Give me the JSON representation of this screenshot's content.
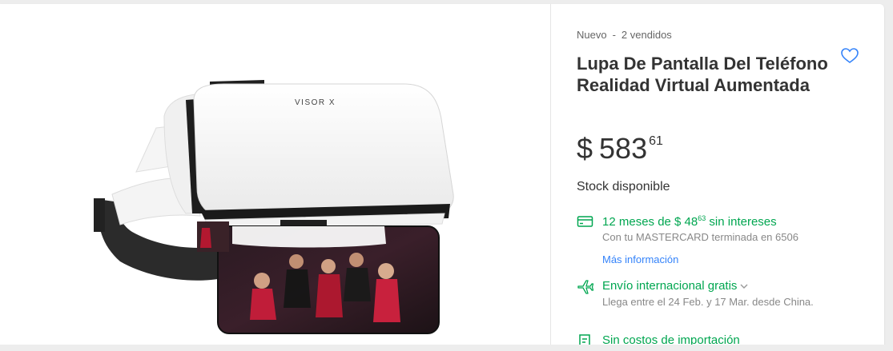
{
  "product": {
    "condition": "Nuevo",
    "separator": "-",
    "sold": "2 vendidos",
    "title": "Lupa De Pantalla Del Teléfono Realidad Virtual Aumentada",
    "image_brand_text": "VISOR X",
    "price": {
      "currency": "$",
      "integer": "583",
      "cents": "61"
    },
    "stock": "Stock disponible"
  },
  "installments": {
    "prefix": "12 meses de $ 48",
    "cents": "63",
    "suffix": " sin intereses",
    "card_note": "Con tu MASTERCARD terminada en 6506",
    "more_info": "Más información"
  },
  "shipping": {
    "label": "Envío internacional gratis",
    "eta": "Llega entre el 24 Feb. y 17 Mar. desde China."
  },
  "import": {
    "label": "Sin costos de importación"
  },
  "colors": {
    "green": "#00a650",
    "blue": "#3483fa"
  },
  "icons": [
    "heart-icon",
    "credit-card-icon",
    "plane-icon",
    "chevron-down-icon",
    "receipt-icon"
  ]
}
